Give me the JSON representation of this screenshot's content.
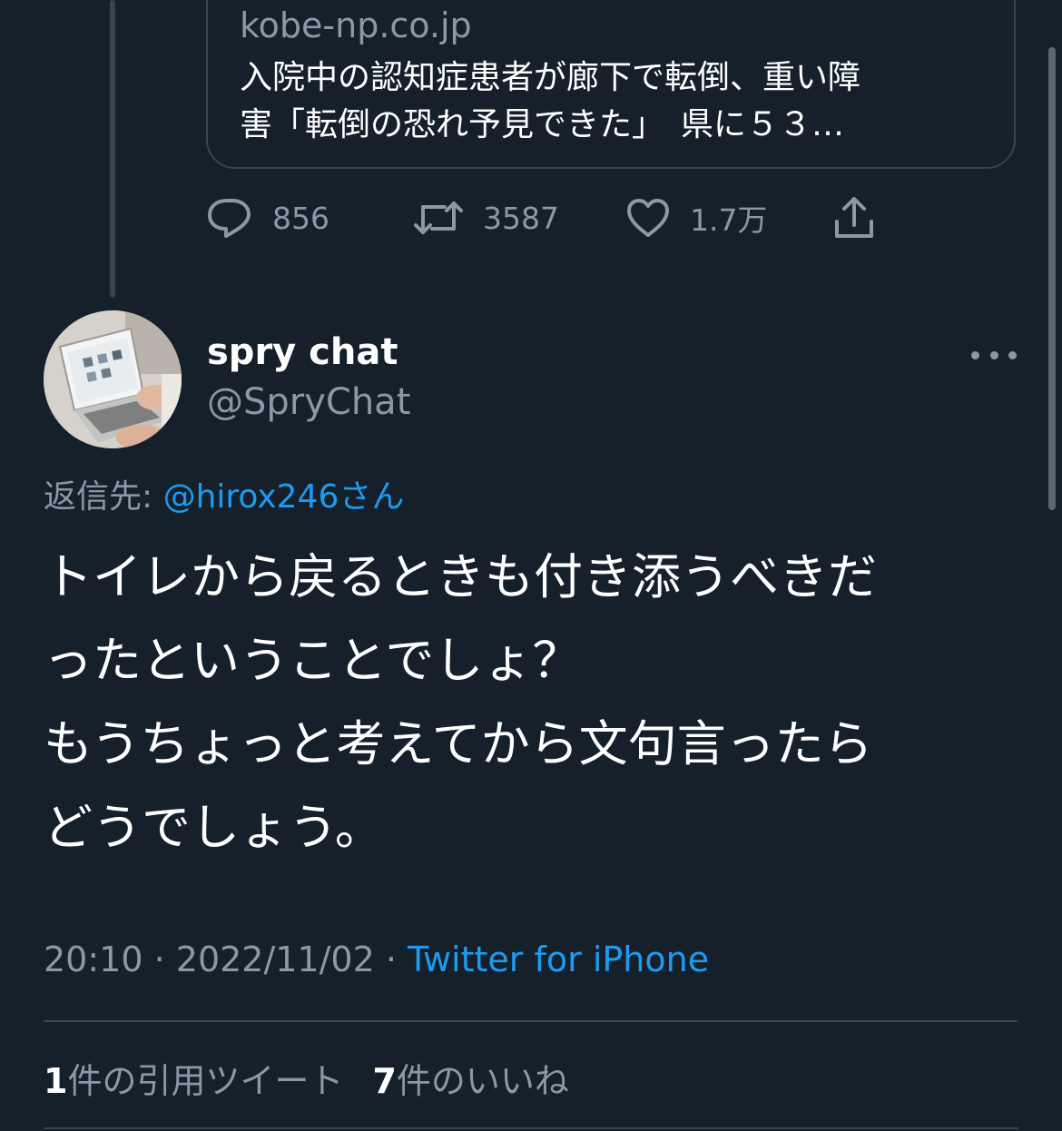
{
  "link_card": {
    "domain": "kobe-np.co.jp",
    "title_line1": "入院中の認知症患者が廊下で転倒、重い障",
    "title_line2": "害「転倒の恐れ予見できた」　県に５３…"
  },
  "actions": {
    "reply_icon": "reply-icon",
    "reply_count": "856",
    "retweet_icon": "retweet-icon",
    "retweet_count": "3587",
    "like_icon": "heart-icon",
    "like_count": "1.7万",
    "share_icon": "share-icon"
  },
  "tweet": {
    "display_name": "spry chat",
    "handle": "@SpryChat",
    "reply_prefix": "返信先: ",
    "reply_mention": "@hirox246",
    "reply_suffix": "さん",
    "text_lines": [
      "トイレから戻るときも付き添うべきだ",
      "ったということでしょ？",
      "もうちょっと考えてから文句言ったら",
      "どうでしょう。"
    ],
    "time": "20:10",
    "sep1": " · ",
    "date": "2022/11/02",
    "sep2": " · ",
    "source": "Twitter for iPhone"
  },
  "stats": {
    "quote_count": "1",
    "quote_label": "件の引用ツイート",
    "like_count": "7",
    "like_label": "件のいいね"
  },
  "colors": {
    "background": "#15202b",
    "text_primary": "#ffffff",
    "text_secondary": "#8b98a5",
    "accent": "#1d9bf0",
    "border": "#38444d"
  }
}
